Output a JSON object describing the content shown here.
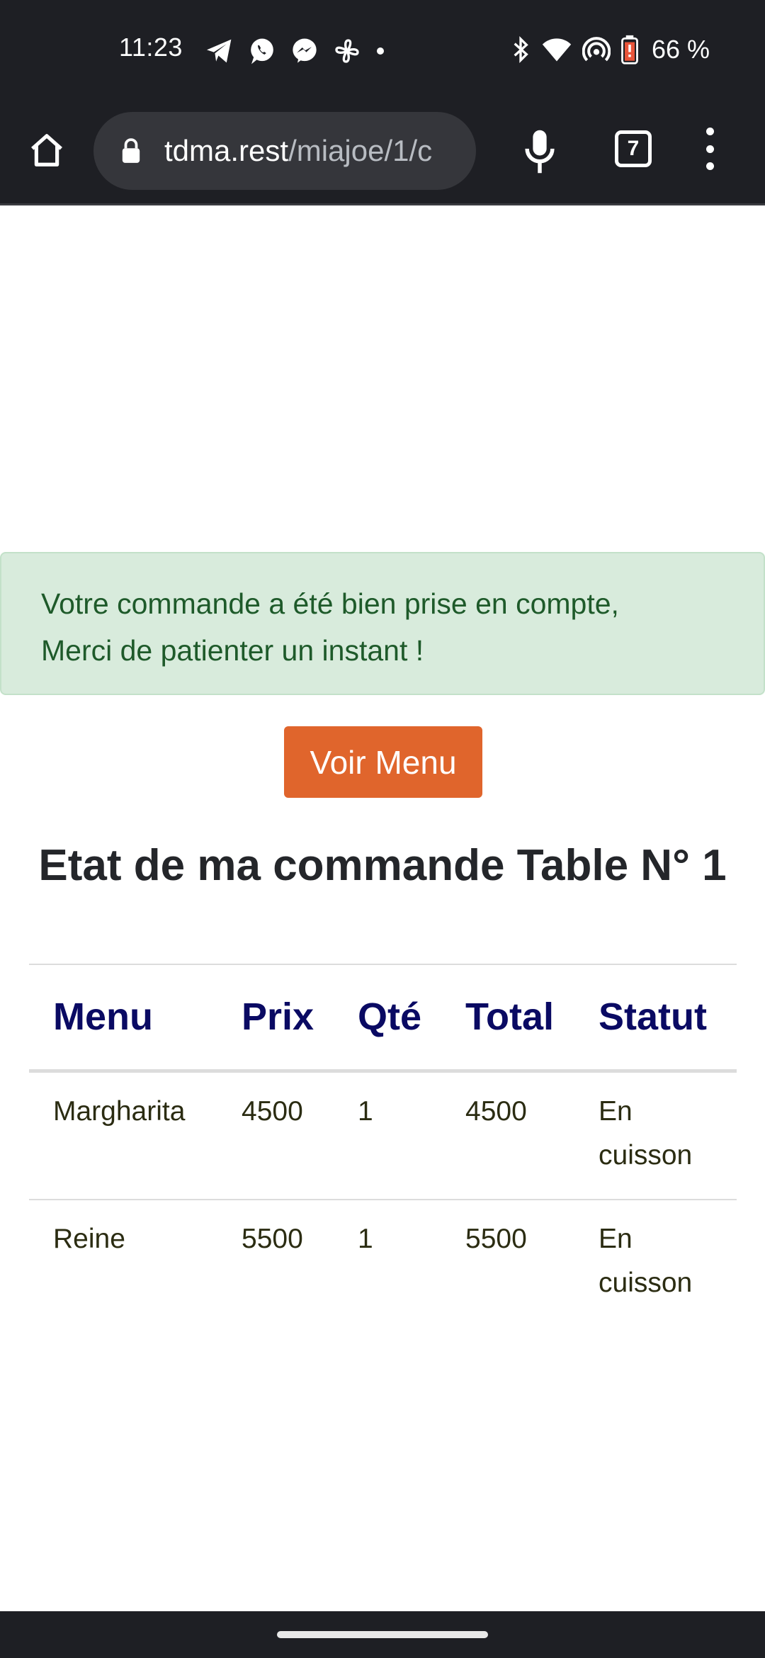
{
  "status_bar": {
    "time": "11:23",
    "battery": "66 %",
    "left_icons": [
      "telegram-icon",
      "whatsapp-icon",
      "messenger-icon",
      "pinwheel-icon",
      "dot-icon"
    ],
    "right_icons": [
      "bluetooth-icon",
      "wifi-icon",
      "hotspot-icon",
      "battery-icon"
    ]
  },
  "browser": {
    "url_host": "tdma.rest",
    "url_path": "/miajoe/1/c",
    "tab_count": "7"
  },
  "alert": {
    "line1": "Votre commande a été bien prise en compte,",
    "line2": "Merci de patienter un instant !"
  },
  "voir_menu_label": "Voir Menu",
  "page_title": "Etat de ma commande Table N° 1",
  "table": {
    "headers": {
      "menu": "Menu",
      "prix": "Prix",
      "qte": "Qté",
      "total": "Total",
      "statut": "Statut"
    },
    "rows": [
      {
        "menu": "Margharita",
        "prix": "4500",
        "qte": "1",
        "total": "4500",
        "statut_line1": "En",
        "statut_line2": "cuisson"
      },
      {
        "menu": "Reine",
        "prix": "5500",
        "qte": "1",
        "total": "5500",
        "statut_line1": "En",
        "statut_line2": "cuisson"
      }
    ]
  },
  "colors": {
    "system_bar": "#1e1f24",
    "alert_bg": "#d8ebdc",
    "alert_text": "#1e5a2a",
    "button": "#e0652c",
    "table_header": "#0a0a63"
  }
}
